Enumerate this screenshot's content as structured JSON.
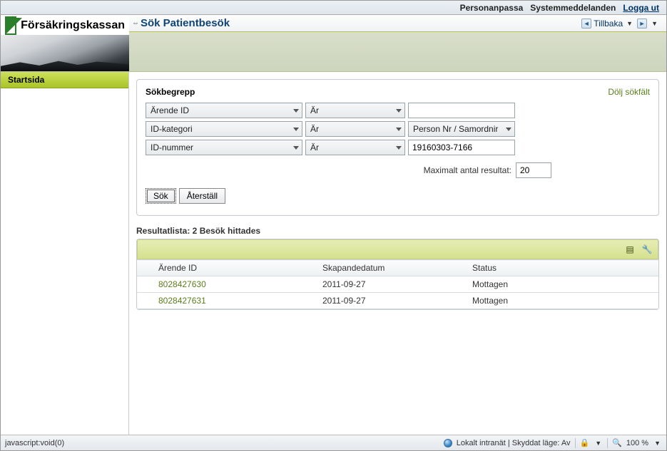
{
  "topnav": {
    "personalize": "Personanpassa",
    "messages": "Systemmeddelanden",
    "logout": "Logga ut"
  },
  "brand": "Försäkringskassan",
  "page": {
    "title": "Sök Patientbesök",
    "back": "Tillbaka"
  },
  "sidebar": {
    "home": "Startsida"
  },
  "search": {
    "heading": "Sökbegrepp",
    "hide_link": "Dölj sökfält",
    "rows": [
      {
        "field": "Ärende ID",
        "op": "Är",
        "value_type": "input",
        "value": ""
      },
      {
        "field": "ID-kategori",
        "op": "Är",
        "value_type": "combo",
        "value": "Person Nr / Samordnir"
      },
      {
        "field": "ID-nummer",
        "op": "Är",
        "value_type": "input",
        "value": "19160303-7166"
      }
    ],
    "max_label": "Maximalt antal resultat:",
    "max_value": "20",
    "search_btn": "Sök",
    "reset_btn": "Återställ"
  },
  "results": {
    "title": "Resultatlista: 2 Besök hittades",
    "columns": {
      "id": "Ärende ID",
      "date": "Skapandedatum",
      "status": "Status"
    },
    "rows": [
      {
        "id": "8028427630",
        "date": "2011-09-27",
        "status": "Mottagen"
      },
      {
        "id": "8028427631",
        "date": "2011-09-27",
        "status": "Mottagen"
      }
    ]
  },
  "statusbar": {
    "left": "javascript:void(0)",
    "zone": "Lokalt intranät | Skyddat läge: Av",
    "zoom": "100 %"
  }
}
